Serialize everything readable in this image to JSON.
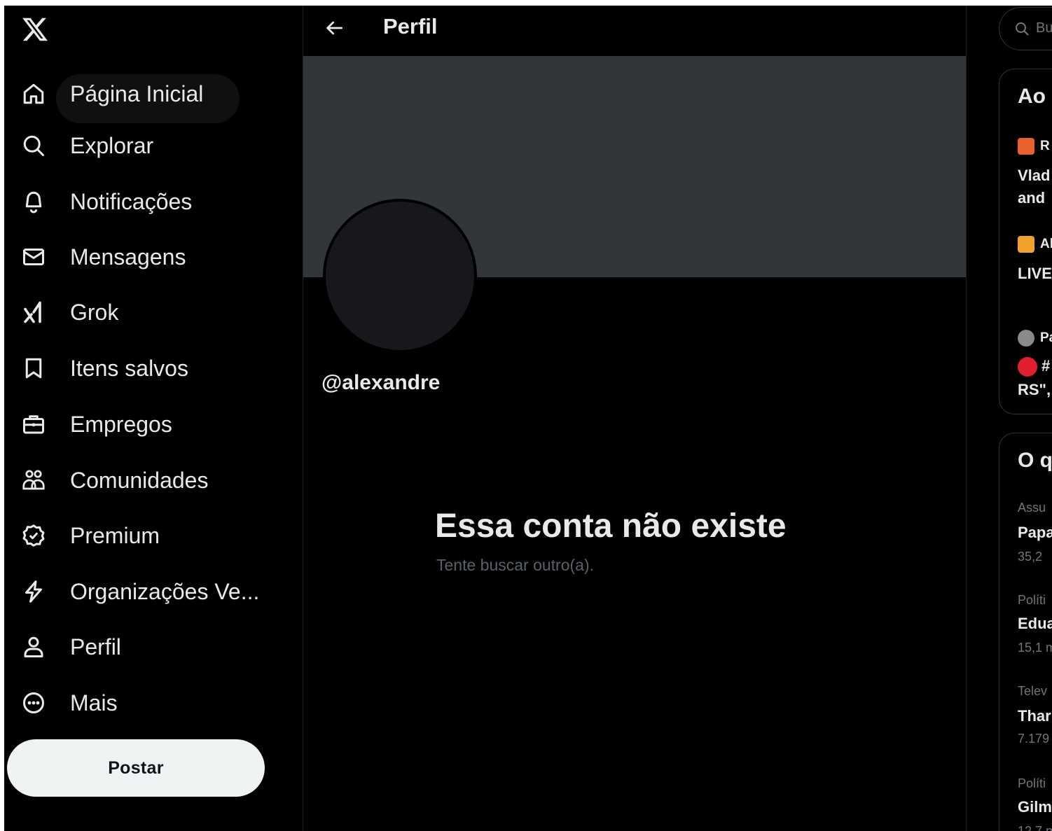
{
  "app": {
    "logo": "x-logo-icon"
  },
  "sidebar": {
    "items": [
      {
        "label": "Página Inicial",
        "icon": "home-icon"
      },
      {
        "label": "Explorar",
        "icon": "search-icon"
      },
      {
        "label": "Notificações",
        "icon": "bell-icon"
      },
      {
        "label": "Mensagens",
        "icon": "envelope-icon"
      },
      {
        "label": "Grok",
        "icon": "grok-icon"
      },
      {
        "label": "Itens salvos",
        "icon": "bookmark-icon"
      },
      {
        "label": "Empregos",
        "icon": "briefcase-icon"
      },
      {
        "label": "Comunidades",
        "icon": "people-icon"
      },
      {
        "label": "Premium",
        "icon": "verified-badge-icon"
      },
      {
        "label": "Organizações Ve...",
        "icon": "lightning-icon"
      },
      {
        "label": "Perfil",
        "icon": "user-icon"
      },
      {
        "label": "Mais",
        "icon": "more-circle-icon"
      }
    ],
    "post_label": "Postar"
  },
  "main": {
    "header_title": "Perfil",
    "handle": "@alexandre",
    "empty_title": "Essa conta não existe",
    "empty_subtitle": "Tente buscar outro(a)."
  },
  "right": {
    "search_placeholder": "Bu",
    "live": {
      "title": "Ao",
      "items": [
        {
          "source": "R",
          "source_color": "#e8612c",
          "text": [
            "Vlad",
            "and"
          ]
        },
        {
          "source": "Al",
          "source_color": "#f0a12a",
          "text": [
            "LIVE"
          ]
        },
        {
          "source": "Pa",
          "source_color": "#8a8a8a",
          "text": [
            "#",
            "RS\","
          ]
        }
      ]
    },
    "trends": {
      "title": "O q",
      "items": [
        {
          "category": "Assu",
          "name": "Papa",
          "count": "35,2"
        },
        {
          "category": "Políti",
          "name": "Edua",
          "count": "15,1 m"
        },
        {
          "category": "Telev",
          "name": "Thar",
          "count": "7.179"
        },
        {
          "category": "Políti",
          "name": "Gilm",
          "count": "12,7 n"
        }
      ]
    }
  },
  "colors": {
    "background": "#000000",
    "banner": "#333639",
    "text_primary": "#e7e9ea",
    "text_secondary": "#71767b",
    "post_button": "#eff3f4"
  }
}
